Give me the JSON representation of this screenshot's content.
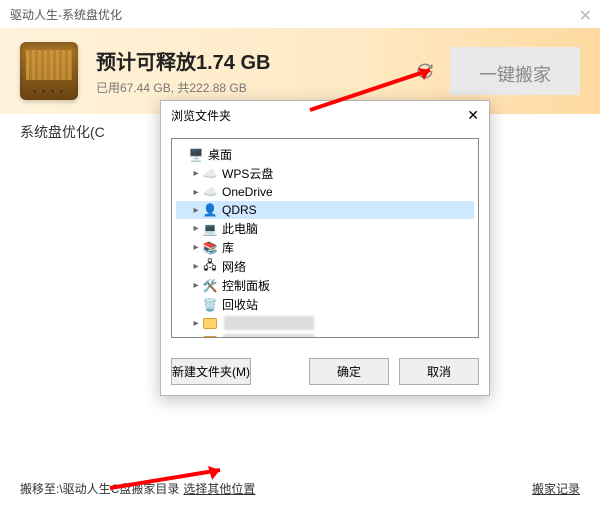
{
  "title": "驱动人生-系统盘优化",
  "header": {
    "headline": "预计可释放1.74 GB",
    "usage": "已用67.44 GB, 共222.88 GB",
    "action_label": "一键搬家"
  },
  "subtitle": "系统盘优化(C",
  "dialog": {
    "title": "浏览文件夹",
    "tree": {
      "root": "桌面",
      "items": [
        {
          "label": "WPS云盘",
          "icon": "cloud"
        },
        {
          "label": "OneDrive",
          "icon": "cloud"
        },
        {
          "label": "QDRS",
          "icon": "user",
          "selected": true
        },
        {
          "label": "此电脑",
          "icon": "pc"
        },
        {
          "label": "库",
          "icon": "lib"
        },
        {
          "label": "网络",
          "icon": "net"
        },
        {
          "label": "控制面板",
          "icon": "ctrl"
        },
        {
          "label": "回收站",
          "icon": "bin"
        }
      ]
    },
    "buttons": {
      "new_folder": "新建文件夹(M)",
      "ok": "确定",
      "cancel": "取消"
    }
  },
  "bottom": {
    "move_to_label": "搬移至:",
    "move_to_path": "\\驱动人生C盘搬家目录",
    "choose_other": "选择其他位置",
    "history": "搬家记录"
  }
}
